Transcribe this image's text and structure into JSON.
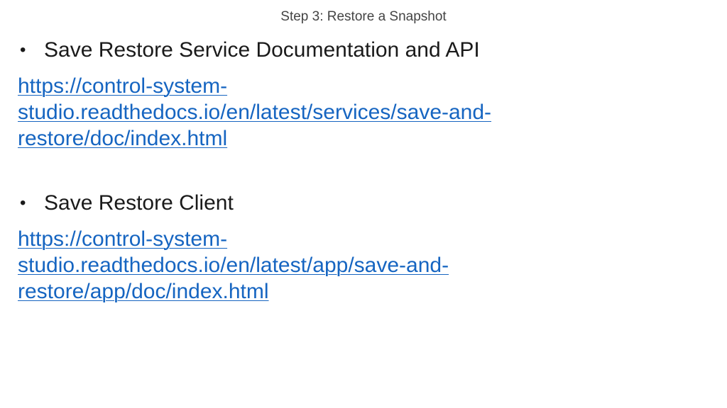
{
  "slide": {
    "title": "Step 3: Restore a Snapshot",
    "sections": [
      {
        "bullet": "Save Restore Service Documentation and API",
        "link_lines": [
          "https://control-system-",
          "studio.readthedocs.io/en/latest/services/save-and-",
          "restore/doc/index.html"
        ]
      },
      {
        "bullet": "Save Restore Client",
        "link_lines": [
          "https://control-system-",
          "studio.readthedocs.io/en/latest/app/save-and-",
          "restore/app/doc/index.html"
        ]
      }
    ]
  },
  "colors": {
    "link": "#1665c1",
    "text": "#1a1a1a",
    "title": "#444444"
  }
}
